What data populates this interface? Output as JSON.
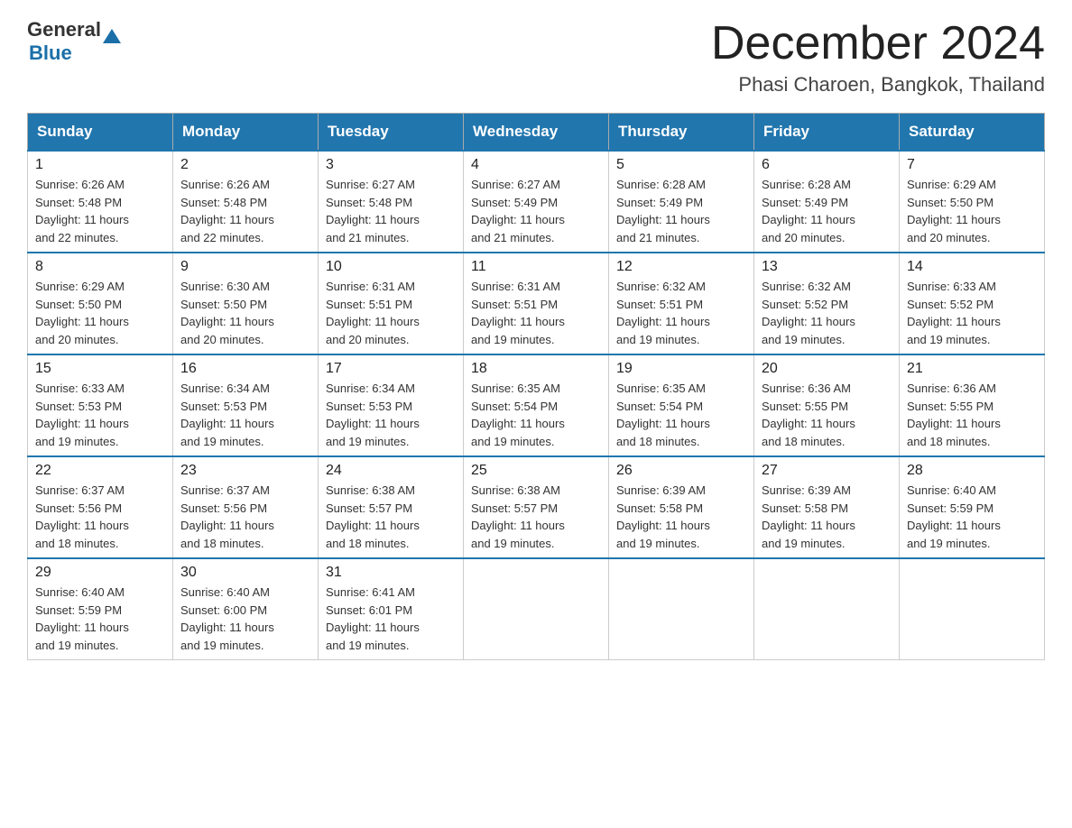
{
  "header": {
    "logo_general": "General",
    "logo_blue": "Blue",
    "month_title": "December 2024",
    "location": "Phasi Charoen, Bangkok, Thailand"
  },
  "weekdays": [
    "Sunday",
    "Monday",
    "Tuesday",
    "Wednesday",
    "Thursday",
    "Friday",
    "Saturday"
  ],
  "weeks": [
    [
      {
        "day": "1",
        "info": "Sunrise: 6:26 AM\nSunset: 5:48 PM\nDaylight: 11 hours\nand 22 minutes."
      },
      {
        "day": "2",
        "info": "Sunrise: 6:26 AM\nSunset: 5:48 PM\nDaylight: 11 hours\nand 22 minutes."
      },
      {
        "day": "3",
        "info": "Sunrise: 6:27 AM\nSunset: 5:48 PM\nDaylight: 11 hours\nand 21 minutes."
      },
      {
        "day": "4",
        "info": "Sunrise: 6:27 AM\nSunset: 5:49 PM\nDaylight: 11 hours\nand 21 minutes."
      },
      {
        "day": "5",
        "info": "Sunrise: 6:28 AM\nSunset: 5:49 PM\nDaylight: 11 hours\nand 21 minutes."
      },
      {
        "day": "6",
        "info": "Sunrise: 6:28 AM\nSunset: 5:49 PM\nDaylight: 11 hours\nand 20 minutes."
      },
      {
        "day": "7",
        "info": "Sunrise: 6:29 AM\nSunset: 5:50 PM\nDaylight: 11 hours\nand 20 minutes."
      }
    ],
    [
      {
        "day": "8",
        "info": "Sunrise: 6:29 AM\nSunset: 5:50 PM\nDaylight: 11 hours\nand 20 minutes."
      },
      {
        "day": "9",
        "info": "Sunrise: 6:30 AM\nSunset: 5:50 PM\nDaylight: 11 hours\nand 20 minutes."
      },
      {
        "day": "10",
        "info": "Sunrise: 6:31 AM\nSunset: 5:51 PM\nDaylight: 11 hours\nand 20 minutes."
      },
      {
        "day": "11",
        "info": "Sunrise: 6:31 AM\nSunset: 5:51 PM\nDaylight: 11 hours\nand 19 minutes."
      },
      {
        "day": "12",
        "info": "Sunrise: 6:32 AM\nSunset: 5:51 PM\nDaylight: 11 hours\nand 19 minutes."
      },
      {
        "day": "13",
        "info": "Sunrise: 6:32 AM\nSunset: 5:52 PM\nDaylight: 11 hours\nand 19 minutes."
      },
      {
        "day": "14",
        "info": "Sunrise: 6:33 AM\nSunset: 5:52 PM\nDaylight: 11 hours\nand 19 minutes."
      }
    ],
    [
      {
        "day": "15",
        "info": "Sunrise: 6:33 AM\nSunset: 5:53 PM\nDaylight: 11 hours\nand 19 minutes."
      },
      {
        "day": "16",
        "info": "Sunrise: 6:34 AM\nSunset: 5:53 PM\nDaylight: 11 hours\nand 19 minutes."
      },
      {
        "day": "17",
        "info": "Sunrise: 6:34 AM\nSunset: 5:53 PM\nDaylight: 11 hours\nand 19 minutes."
      },
      {
        "day": "18",
        "info": "Sunrise: 6:35 AM\nSunset: 5:54 PM\nDaylight: 11 hours\nand 19 minutes."
      },
      {
        "day": "19",
        "info": "Sunrise: 6:35 AM\nSunset: 5:54 PM\nDaylight: 11 hours\nand 18 minutes."
      },
      {
        "day": "20",
        "info": "Sunrise: 6:36 AM\nSunset: 5:55 PM\nDaylight: 11 hours\nand 18 minutes."
      },
      {
        "day": "21",
        "info": "Sunrise: 6:36 AM\nSunset: 5:55 PM\nDaylight: 11 hours\nand 18 minutes."
      }
    ],
    [
      {
        "day": "22",
        "info": "Sunrise: 6:37 AM\nSunset: 5:56 PM\nDaylight: 11 hours\nand 18 minutes."
      },
      {
        "day": "23",
        "info": "Sunrise: 6:37 AM\nSunset: 5:56 PM\nDaylight: 11 hours\nand 18 minutes."
      },
      {
        "day": "24",
        "info": "Sunrise: 6:38 AM\nSunset: 5:57 PM\nDaylight: 11 hours\nand 18 minutes."
      },
      {
        "day": "25",
        "info": "Sunrise: 6:38 AM\nSunset: 5:57 PM\nDaylight: 11 hours\nand 19 minutes."
      },
      {
        "day": "26",
        "info": "Sunrise: 6:39 AM\nSunset: 5:58 PM\nDaylight: 11 hours\nand 19 minutes."
      },
      {
        "day": "27",
        "info": "Sunrise: 6:39 AM\nSunset: 5:58 PM\nDaylight: 11 hours\nand 19 minutes."
      },
      {
        "day": "28",
        "info": "Sunrise: 6:40 AM\nSunset: 5:59 PM\nDaylight: 11 hours\nand 19 minutes."
      }
    ],
    [
      {
        "day": "29",
        "info": "Sunrise: 6:40 AM\nSunset: 5:59 PM\nDaylight: 11 hours\nand 19 minutes."
      },
      {
        "day": "30",
        "info": "Sunrise: 6:40 AM\nSunset: 6:00 PM\nDaylight: 11 hours\nand 19 minutes."
      },
      {
        "day": "31",
        "info": "Sunrise: 6:41 AM\nSunset: 6:01 PM\nDaylight: 11 hours\nand 19 minutes."
      },
      {
        "day": "",
        "info": ""
      },
      {
        "day": "",
        "info": ""
      },
      {
        "day": "",
        "info": ""
      },
      {
        "day": "",
        "info": ""
      }
    ]
  ]
}
